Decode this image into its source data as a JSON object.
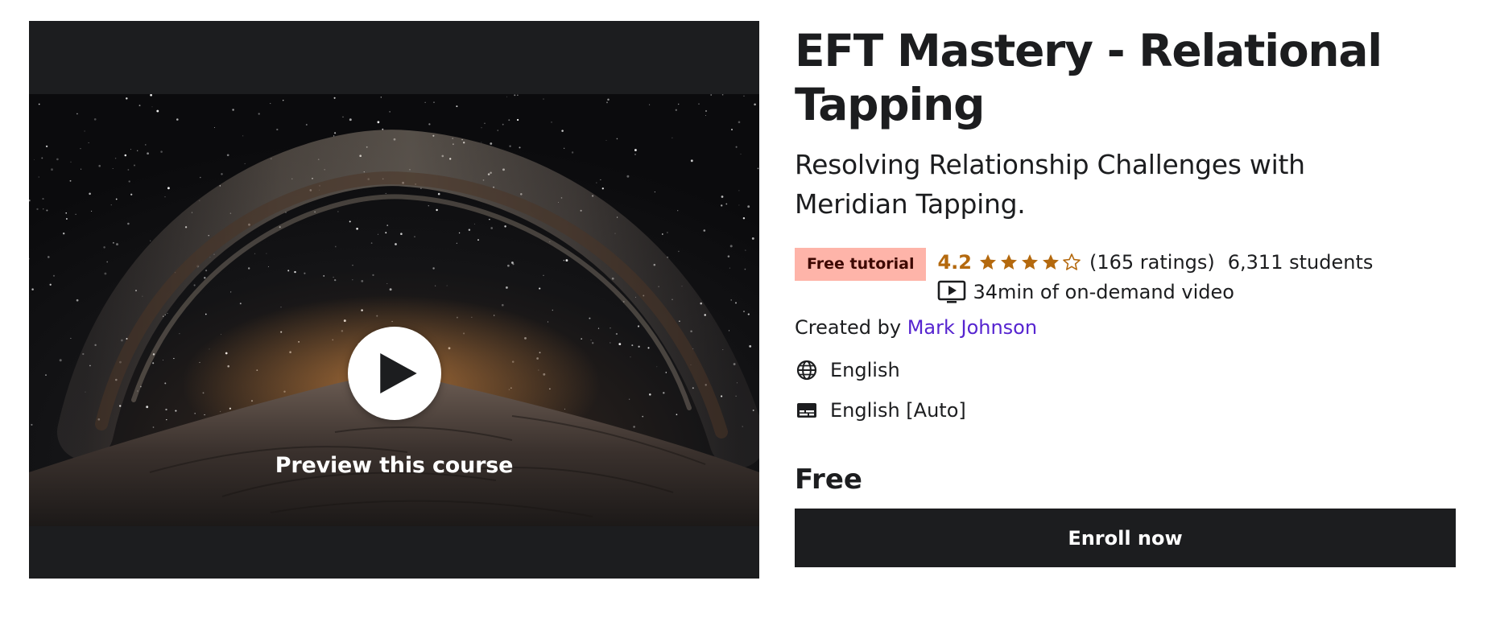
{
  "preview": {
    "label": "Preview this course",
    "image_icon": "milky-way-desert-image"
  },
  "course": {
    "title": "EFT Mastery - Relational Tapping",
    "subtitle": "Resolving Relationship Challenges with Meridian Tapping.",
    "badge": "Free tutorial",
    "rating": "4.2",
    "rating_fraction_of_five": 0.84,
    "ratings_count": "(165 ratings)",
    "students": "6,311 students",
    "video_length": "34min of on-demand video",
    "created_by_label": "Created by",
    "instructor": "Mark Johnson",
    "language": "English",
    "captions": "English [Auto]",
    "price": "Free",
    "enroll_label": "Enroll now"
  },
  "colors": {
    "rating": "#b4690e",
    "badge_bg": "#feb4a9",
    "badge_text": "#3d0801",
    "link": "#5624d0",
    "button_bg": "#1c1d1f"
  }
}
